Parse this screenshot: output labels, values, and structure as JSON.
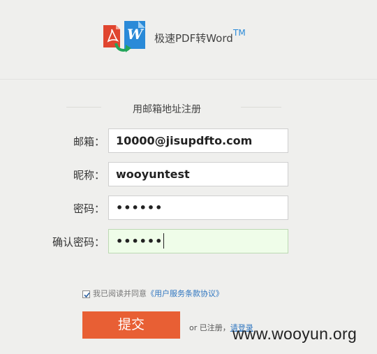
{
  "header": {
    "brand_name": "极速PDF转Word",
    "trademark": "TM"
  },
  "form": {
    "section_title": "用邮箱地址注册",
    "fields": [
      {
        "label": "邮箱：",
        "value": "10000@jisupdfto.com"
      },
      {
        "label": "昵称：",
        "value": "wooyuntest"
      },
      {
        "label": "密码：",
        "value": "••••••"
      },
      {
        "label": "确认密码：",
        "value": "••••••"
      }
    ],
    "agree_prefix": "我已阅读并同意",
    "agree_link": "《用户服务条款协议》",
    "agree_checked": true,
    "submit_label": "提交",
    "login_prefix": "or 已注册，",
    "login_link": "请登录"
  },
  "watermark": "www.wooyun.org",
  "colors": {
    "submit": "#e85f34",
    "link": "#2f76c0",
    "active_field": "#effde9"
  }
}
